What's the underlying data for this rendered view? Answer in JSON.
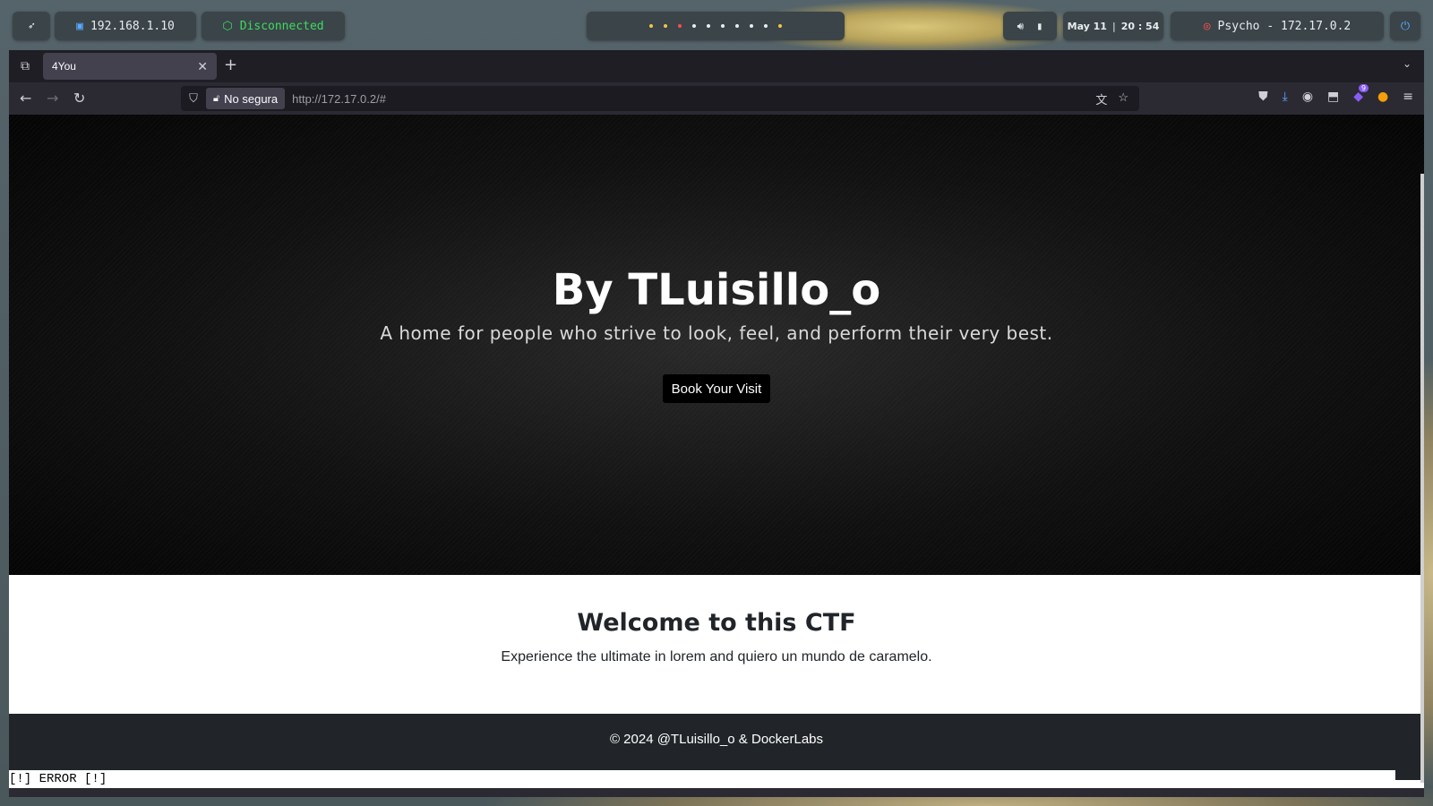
{
  "panel": {
    "ip": "192.168.1.10",
    "vpn_status": "Disconnected",
    "date": "May 11",
    "time": "20 : 54",
    "target": "Psycho - 172.17.0.2",
    "workspace_count": 10
  },
  "browser": {
    "tab_title": "4You",
    "security_label": "No segura",
    "url": "http://172.17.0.2/#",
    "extension_badge": "9"
  },
  "page": {
    "hero_title": "By TLuisillo_o",
    "hero_subtitle": "A home for people who strive to look, feel, and perform their very best.",
    "hero_button": "Book Your Visit",
    "section_title": "Welcome to this CTF",
    "section_text": "Experience the ultimate in lorem and quiero un mundo de caramelo.",
    "footer": "© 2024 @TLuisillo_o & DockerLabs",
    "status_line": "[!] ERROR [!]"
  },
  "colors": {
    "vpn_green": "#3ddc5e",
    "target_red": "#ff4d4d",
    "hero_bg": "#111111",
    "footer_bg": "#212529"
  }
}
